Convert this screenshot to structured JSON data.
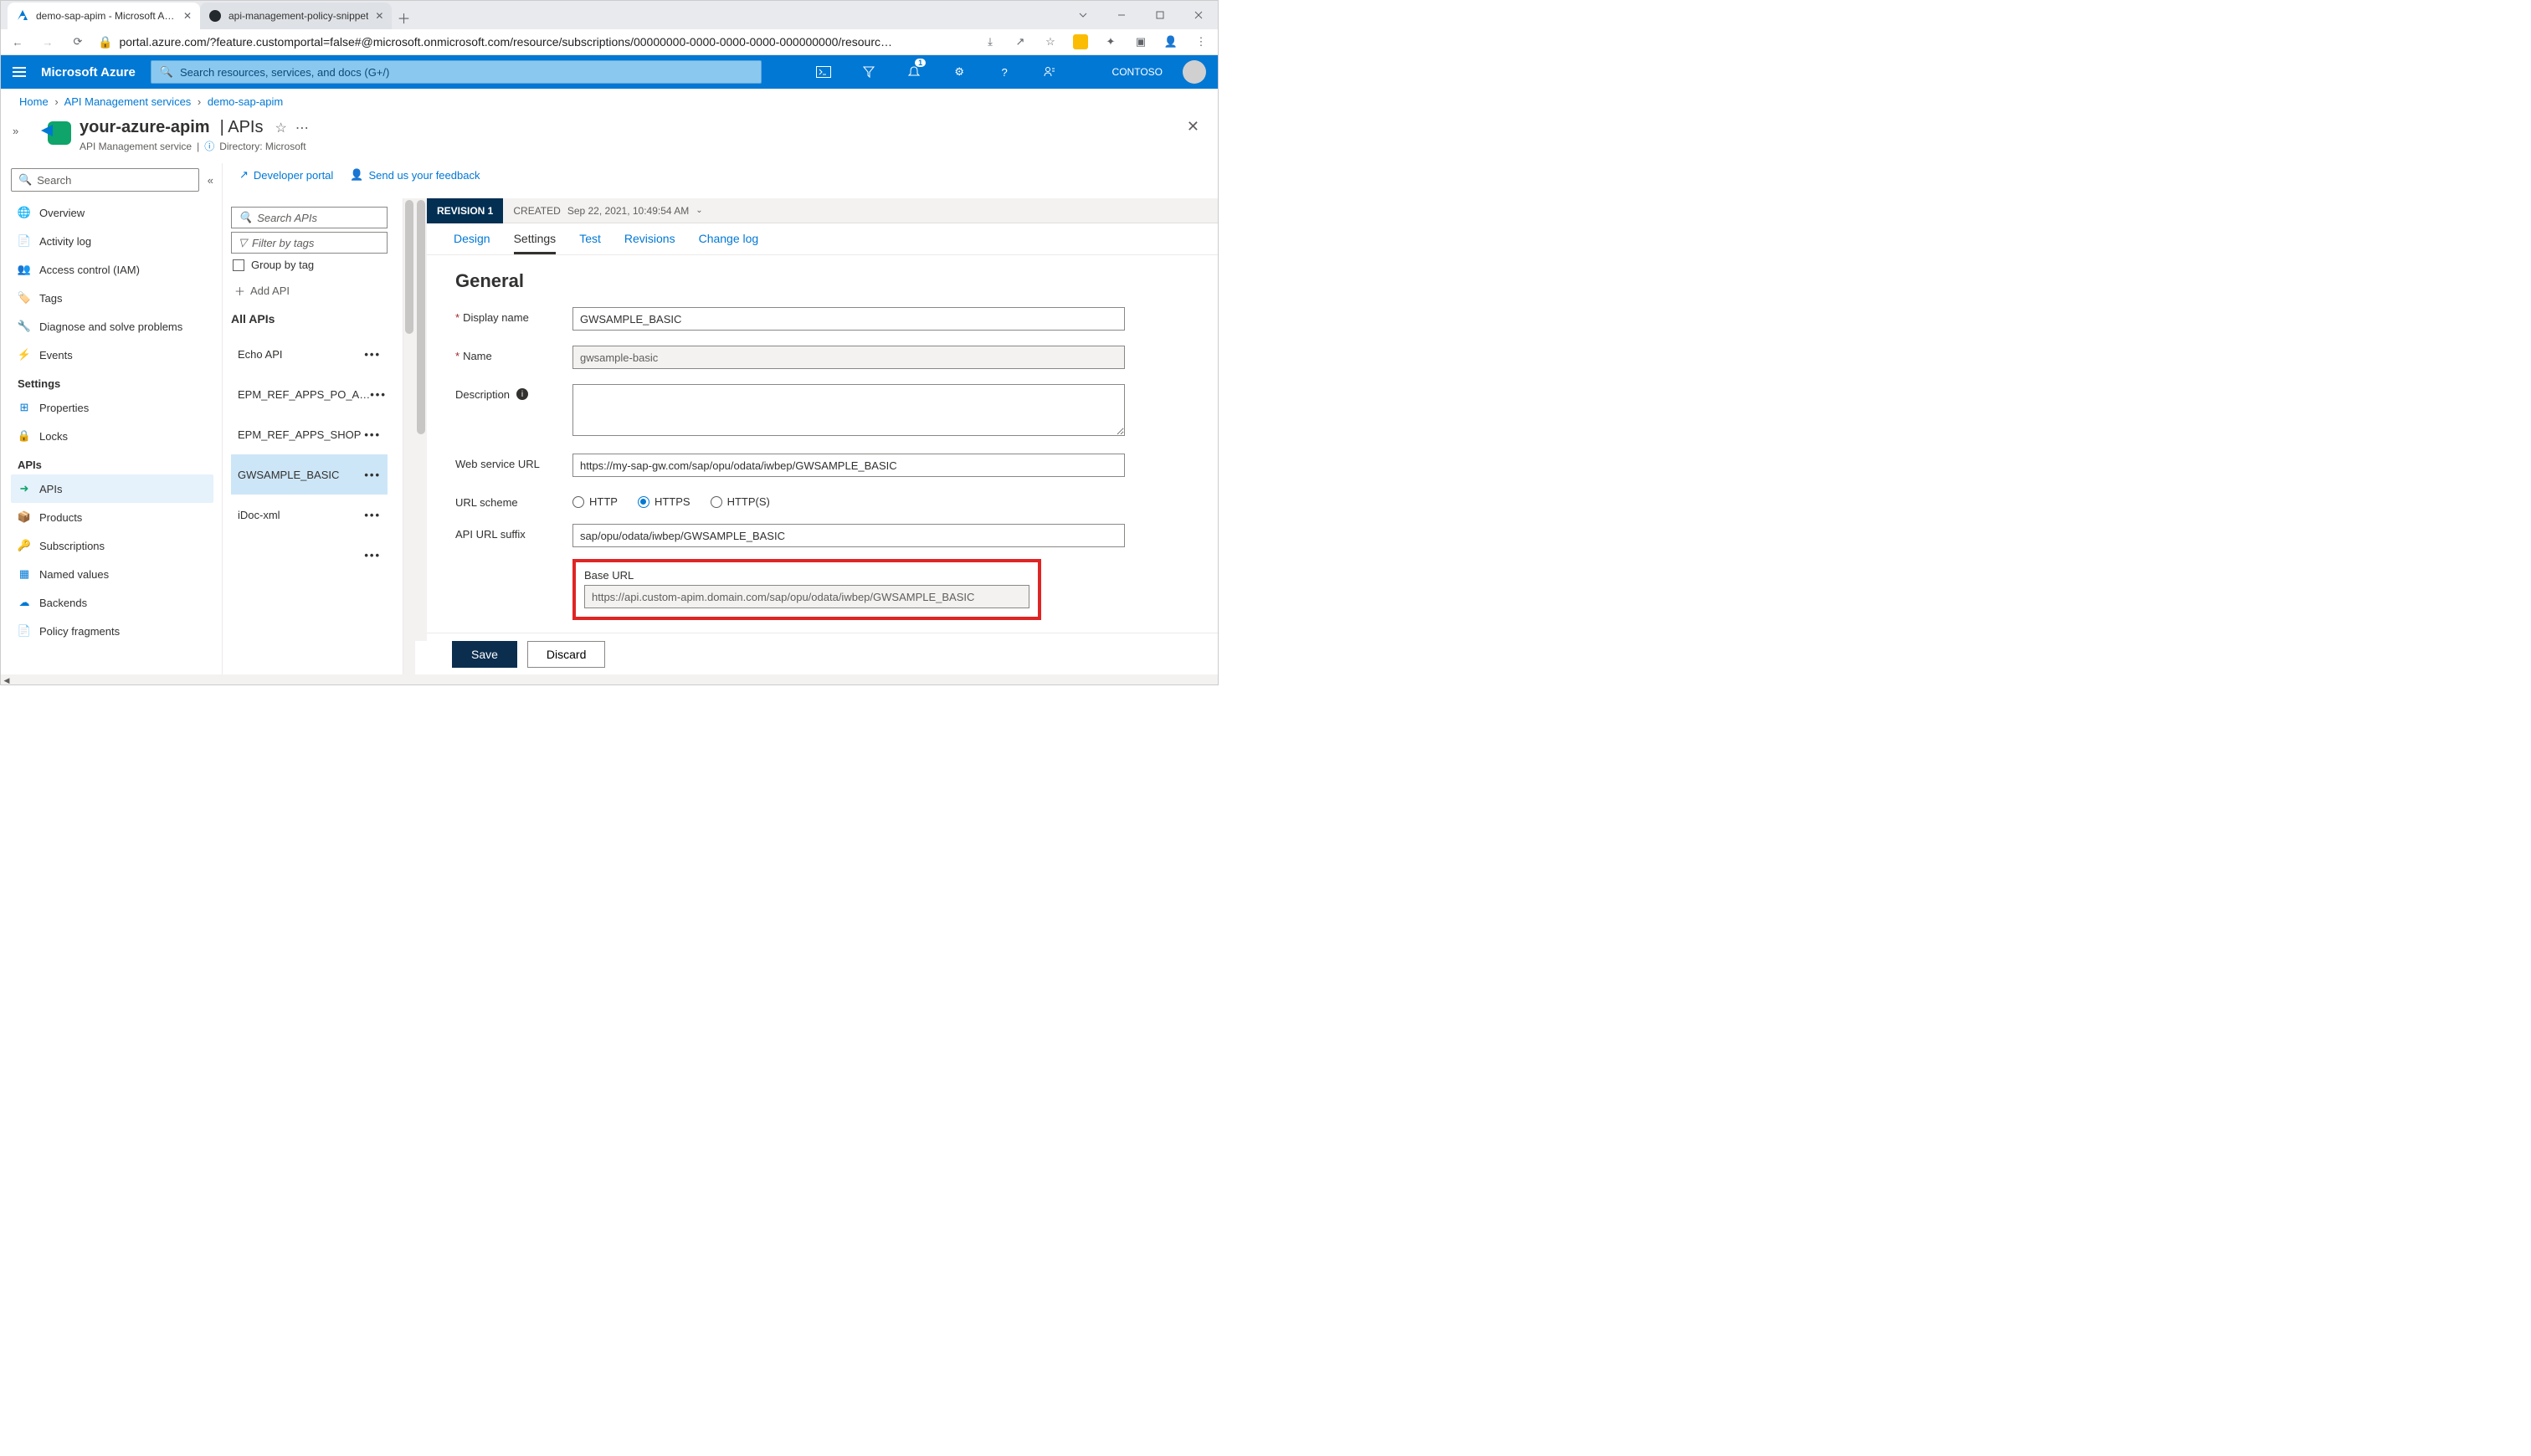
{
  "browser": {
    "tabs": [
      {
        "title": "demo-sap-apim - Microsoft Azur",
        "active": true
      },
      {
        "title": "api-management-policy-snippet",
        "active": false
      }
    ],
    "url_display": "portal.azure.com/?feature.customportal=false#@microsoft.onmicrosoft.com/resource/subscriptions/00000000-0000-0000-0000-000000000/resourc…"
  },
  "azure": {
    "brand": "Microsoft Azure",
    "search_placeholder": "Search resources, services, and docs (G+/)",
    "notif_count": "1",
    "tenant": "CONTOSO"
  },
  "breadcrumb": [
    {
      "label": "Home"
    },
    {
      "label": "API Management services"
    },
    {
      "label": "demo-sap-apim"
    }
  ],
  "blade": {
    "name": "your-azure-apim",
    "section": "| APIs",
    "subtitle": "API Management service",
    "directory_label": "Directory: Microsoft"
  },
  "leftnav": {
    "search_placeholder": "Search",
    "top": [
      {
        "label": "Overview",
        "icon": "globe"
      },
      {
        "label": "Activity log",
        "icon": "log"
      },
      {
        "label": "Access control (IAM)",
        "icon": "people"
      },
      {
        "label": "Tags",
        "icon": "tag"
      },
      {
        "label": "Diagnose and solve problems",
        "icon": "wrench"
      },
      {
        "label": "Events",
        "icon": "bolt"
      }
    ],
    "grp_settings": "Settings",
    "settings": [
      {
        "label": "Properties",
        "icon": "props"
      },
      {
        "label": "Locks",
        "icon": "lock"
      }
    ],
    "grp_apis": "APIs",
    "apis": [
      {
        "label": "APIs",
        "icon": "api",
        "active": true
      },
      {
        "label": "Products",
        "icon": "prod"
      },
      {
        "label": "Subscriptions",
        "icon": "key"
      },
      {
        "label": "Named values",
        "icon": "grid"
      },
      {
        "label": "Backends",
        "icon": "cloud"
      },
      {
        "label": "Policy fragments",
        "icon": "doc"
      }
    ]
  },
  "apilist": {
    "toolbar": {
      "dev_portal": "Developer portal",
      "feedback": "Send us your feedback"
    },
    "search_placeholder": "Search APIs",
    "filter_placeholder": "Filter by tags",
    "group_by_tag": "Group by tag",
    "add_api": "Add API",
    "all_apis": "All APIs",
    "items": [
      {
        "label": "Echo API"
      },
      {
        "label": "EPM_REF_APPS_PO_A…"
      },
      {
        "label": "EPM_REF_APPS_SHOP"
      },
      {
        "label": "GWSAMPLE_BASIC",
        "selected": true
      },
      {
        "label": "iDoc-xml"
      },
      {
        "label": ""
      }
    ]
  },
  "detail": {
    "revision_tag": "REVISION 1",
    "created_label": "CREATED",
    "created_value": "Sep 22, 2021, 10:49:54 AM",
    "tabs": [
      {
        "label": "Design"
      },
      {
        "label": "Settings",
        "active": true
      },
      {
        "label": "Test"
      },
      {
        "label": "Revisions"
      },
      {
        "label": "Change log"
      }
    ],
    "heading": "General",
    "fields": {
      "display_name_label": "Display name",
      "display_name_value": "GWSAMPLE_BASIC",
      "name_label": "Name",
      "name_value": "gwsample-basic",
      "description_label": "Description",
      "description_value": "",
      "web_url_label": "Web service URL",
      "web_url_value": "https://my-sap-gw.com/sap/opu/odata/iwbep/GWSAMPLE_BASIC",
      "url_scheme_label": "URL scheme",
      "scheme_http": "HTTP",
      "scheme_https": "HTTPS",
      "scheme_both": "HTTP(S)",
      "suffix_label": "API URL suffix",
      "suffix_value": "sap/opu/odata/iwbep/GWSAMPLE_BASIC",
      "base_url_label": "Base URL",
      "base_url_value": "https://api.custom-apim.domain.com/sap/opu/odata/iwbep/GWSAMPLE_BASIC"
    },
    "save": "Save",
    "discard": "Discard"
  }
}
